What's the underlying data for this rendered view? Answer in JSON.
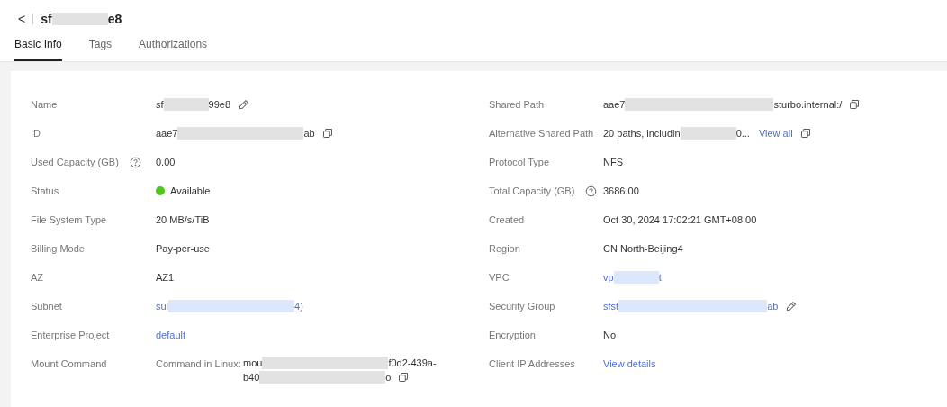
{
  "header": {
    "back": "<",
    "title": [
      "sf",
      "e8"
    ]
  },
  "tabs": [
    {
      "label": "Basic Info",
      "selected": true
    },
    {
      "label": "Tags",
      "selected": false
    },
    {
      "label": "Authorizations",
      "selected": false
    }
  ],
  "left": [
    {
      "label": "Name",
      "kind": "text",
      "parts": [
        "sf",
        "99e8"
      ],
      "editable": true
    },
    {
      "label": "ID",
      "kind": "text",
      "parts": [
        "aae7",
        "ab"
      ],
      "copyable": true
    },
    {
      "label": "Used Capacity (GB)",
      "help": true,
      "kind": "text",
      "parts": [
        "0.00"
      ]
    },
    {
      "label": "Status",
      "kind": "status",
      "parts": [
        "Available"
      ],
      "color": "#52c41a"
    },
    {
      "label": "File System Type",
      "kind": "text",
      "parts": [
        "20 MB/s/TiB"
      ]
    },
    {
      "label": "Billing Mode",
      "kind": "text",
      "parts": [
        "Pay-per-use"
      ]
    },
    {
      "label": "AZ",
      "kind": "text",
      "parts": [
        "AZ1"
      ]
    },
    {
      "label": "Subnet",
      "kind": "link",
      "parts": [
        "sul",
        "4)"
      ]
    },
    {
      "label": "Enterprise Project",
      "kind": "link",
      "parts": [
        "default"
      ]
    },
    {
      "label": "Mount Command",
      "kind": "command",
      "sublabel": "Command in Linux:",
      "lines": [
        [
          "mou",
          "f0d2-439a-"
        ],
        [
          "b40",
          "o"
        ]
      ],
      "copyable": true
    }
  ],
  "right": [
    {
      "label": "Shared Path",
      "kind": "text",
      "parts": [
        "aae7",
        "sturbo.internal:/"
      ],
      "copyable": true
    },
    {
      "label": "Alternative Shared Path",
      "kind": "text",
      "parts": [
        "20 paths, includin",
        "0..."
      ],
      "link": "View all",
      "copyable": true
    },
    {
      "label": "Protocol Type",
      "kind": "text",
      "parts": [
        "NFS"
      ]
    },
    {
      "label": "Total Capacity (GB)",
      "help": true,
      "kind": "text",
      "parts": [
        "3686.00"
      ]
    },
    {
      "label": "Created",
      "kind": "text",
      "parts": [
        "Oct 30, 2024 17:02:21 GMT+08:00"
      ]
    },
    {
      "label": "Region",
      "kind": "text",
      "parts": [
        "CN North-Beijing4"
      ]
    },
    {
      "label": "VPC",
      "kind": "link",
      "parts": [
        "vp",
        "t"
      ]
    },
    {
      "label": "Security Group",
      "kind": "link",
      "parts": [
        "sfst",
        "ab"
      ],
      "editable": true
    },
    {
      "label": "Encryption",
      "kind": "text",
      "parts": [
        "No"
      ]
    },
    {
      "label": "Client IP Addresses",
      "kind": "link",
      "parts": [
        "View details"
      ]
    }
  ]
}
